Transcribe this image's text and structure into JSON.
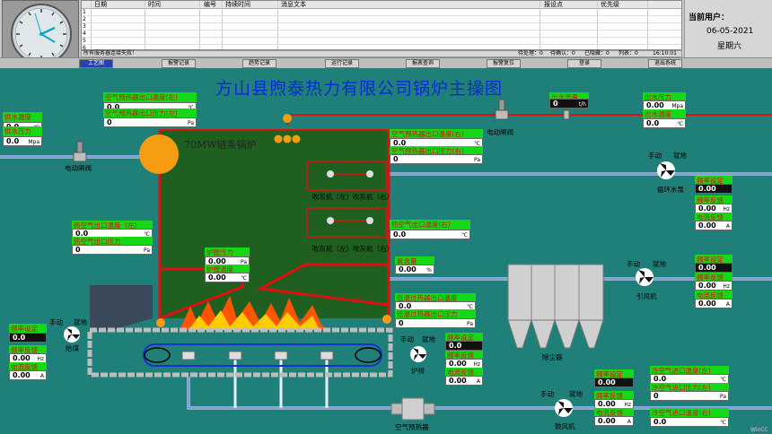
{
  "clock": {
    "time": "16:10:01"
  },
  "alarm_table": {
    "columns": [
      "日期",
      "时间",
      "编号",
      "持续时间",
      "消息文本",
      "报设点",
      "优先级"
    ],
    "row_numbers": [
      "1",
      "2",
      "3",
      "4",
      "5",
      "6"
    ]
  },
  "status": {
    "message": "所有服务器连接失败！",
    "pending": "待处理：0",
    "confirmed": "待确认：0",
    "hidden": "已隐藏：0",
    "list": "列表：0",
    "time": "16:10:01"
  },
  "user": {
    "label": "当前用户：",
    "date": "06-05-2021",
    "weekday": "星期六"
  },
  "nav": {
    "items": [
      "工艺图",
      "报警记录",
      "趋势记录",
      "运行记录",
      "报表查询",
      "报警复位",
      "登录",
      "退出系统"
    ]
  },
  "title": "方山县煦泰热力有限公司锅炉主操图",
  "boiler_name": "70MW链条锅炉",
  "boxes": {
    "supply_temp": {
      "label": "供水温度",
      "value": "0.0",
      "unit": "℃"
    },
    "supply_press": {
      "label": "供水压力",
      "value": "0.0",
      "unit": "Mpa"
    },
    "ap_inlet_temp_l": {
      "label": "空气预热器出口温度(左)",
      "value": "0.0",
      "unit": "℃"
    },
    "ap_inlet_press_l": {
      "label": "空气预热器出口压力(左)",
      "value": "0",
      "unit": "Pa"
    },
    "outlet_flow": {
      "label": "出水流量",
      "value": "0",
      "unit": "t/h"
    },
    "outlet_press": {
      "label": "出水压力",
      "value": "0.00",
      "unit": "Mpa"
    },
    "outlet_temp": {
      "label": "出水温度",
      "value": "0.0",
      "unit": "℃"
    },
    "ap_out_temp_r": {
      "label": "空气预热器出口温度(右)",
      "value": "0.0",
      "unit": "℃"
    },
    "ap_out_press_r": {
      "label": "空气预热器出口压力(右)",
      "value": "0",
      "unit": "Pa"
    },
    "hot_air_temp_l": {
      "label": "热空气出口温度（左）",
      "value": "0.0",
      "unit": "℃"
    },
    "hot_air_press_l": {
      "label": "热空气出口压力",
      "value": "0",
      "unit": "Pa"
    },
    "hot_air_temp_r": {
      "label": "热空气出口温度(右)",
      "value": "0.0",
      "unit": "℃"
    },
    "furnace_press": {
      "label": "炉膛压力",
      "value": "0.00",
      "unit": "Pa"
    },
    "furnace_temp": {
      "label": "炉膛温度",
      "value": "0.00",
      "unit": "℃"
    },
    "oxygen": {
      "label": "氧含量",
      "value": "0.00",
      "unit": "%"
    },
    "lowtemp_out_temp": {
      "label": "低温过热器出口温度",
      "value": "0.0",
      "unit": "℃"
    },
    "lowtemp_out_press": {
      "label": "低温过热器出口压力",
      "value": "0",
      "unit": "Pa"
    },
    "cold_air_temp": {
      "label": "冷空气进口温度(左)",
      "value": "0.0",
      "unit": "℃"
    },
    "cold_air_press": {
      "label": "冷空气进口压力(左)",
      "value": "0",
      "unit": "Pa"
    },
    "cold_air_temp_r": {
      "label": "冷空气进口温度(右)",
      "value": "0.0",
      "unit": "℃"
    }
  },
  "motors": {
    "circ_pump": {
      "set_label": "频率设定",
      "set_val": "0.00",
      "fb_label": "频率反馈",
      "fb_val": "0.00",
      "fb_unit": "Hz",
      "cur_label": "电流反馈",
      "cur_val": "0.00",
      "cur_unit": "A",
      "name": "循环水泵"
    },
    "id_fan": {
      "set_label": "频率设定",
      "set_val": "0.00",
      "fb_label": "频率反馈",
      "fb_val": "0.00",
      "fb_unit": "Hz",
      "cur_label": "电流反馈",
      "cur_val": "0.00",
      "cur_unit": "A",
      "name": "引风机"
    },
    "feeder": {
      "set_label": "频率设定",
      "set_val": "0.0",
      "fb_label": "频率反馈",
      "fb_val": "0.00",
      "fb_unit": "Hz",
      "cur_label": "电流反馈",
      "cur_val": "0.00",
      "cur_unit": "A",
      "name": "炉排"
    },
    "grate": {
      "set_label": "频率设定",
      "set_val": "0.0",
      "fb_label": "频率反馈",
      "fb_val": "0.00",
      "fb_unit": "Hz",
      "cur_label": "电流反馈",
      "cur_val": "0.00",
      "cur_unit": "A",
      "name": "炉排"
    },
    "coal_fan": {
      "set_label": "频率设定",
      "set_val": "0.00",
      "fb_label": "频率反馈",
      "fb_val": "0.00",
      "fb_unit": "Hz",
      "cur_label": "电流反馈",
      "cur_val": "0.00",
      "cur_unit": "A",
      "name": "鼓风机"
    }
  },
  "labels": {
    "valve_left": "电动闸阀",
    "valve_top": "电动闸阀",
    "manual": "手动",
    "local": "就地",
    "superheater_l": "吹灰机（左）吹灰机（右）",
    "superheater_r": "吹灰机（左）吹灰机（右）",
    "dust": "除尘器",
    "air_preheater": "空气预热器",
    "coal_feeder": "给煤",
    "wincc": "WinCC"
  }
}
